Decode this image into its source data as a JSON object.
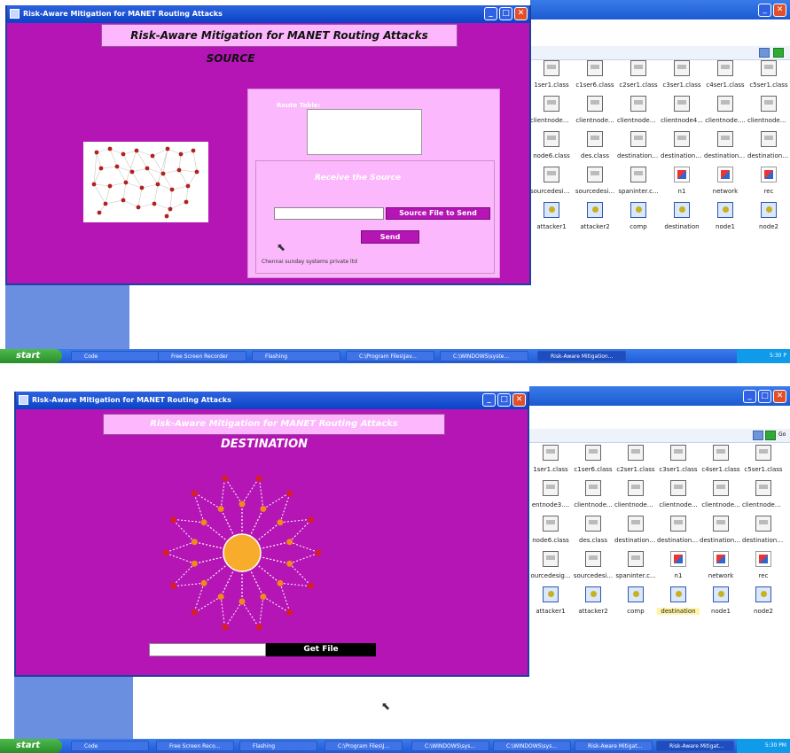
{
  "shot1": {
    "window_title": "Risk-Aware Mitigation for MANET Routing Attacks",
    "header": "Risk-Aware Mitigation for MANET Routing Attacks",
    "role": "SOURCE",
    "route_table_label": "Route Table:",
    "receive_label": "Receive the Source",
    "source_file_button": "Source File to Send",
    "send_button": "Send",
    "footer_note": "Chennai sunday systems private ltd",
    "files": [
      {
        "label": "1ser1.class",
        "kind": "class"
      },
      {
        "label": "c1ser6.class",
        "kind": "class"
      },
      {
        "label": "c2ser1.class",
        "kind": "class"
      },
      {
        "label": "c3ser1.class",
        "kind": "class"
      },
      {
        "label": "c4ser1.class",
        "kind": "class"
      },
      {
        "label": "c5ser1.class",
        "kind": "class"
      },
      {
        "label": "clientnode3....",
        "kind": "class"
      },
      {
        "label": "clientnode...",
        "kind": "class"
      },
      {
        "label": "clientnode4....",
        "kind": "class"
      },
      {
        "label": "clientnode4...",
        "kind": "class"
      },
      {
        "label": "clientnode....",
        "kind": "class"
      },
      {
        "label": "clientnode5....",
        "kind": "class"
      },
      {
        "label": "node6.class",
        "kind": "class"
      },
      {
        "label": "des.class",
        "kind": "class"
      },
      {
        "label": "destination....",
        "kind": "class"
      },
      {
        "label": "destination....",
        "kind": "class"
      },
      {
        "label": "destination....",
        "kind": "class"
      },
      {
        "label": "destination....",
        "kind": "class"
      },
      {
        "label": "sourcedesig...",
        "kind": "class"
      },
      {
        "label": "sourcedesi...",
        "kind": "class"
      },
      {
        "label": "spaninter.c...",
        "kind": "class"
      },
      {
        "label": "n1",
        "kind": "java"
      },
      {
        "label": "network",
        "kind": "java"
      },
      {
        "label": "rec",
        "kind": "java"
      },
      {
        "label": "attacker1",
        "kind": "exe"
      },
      {
        "label": "attacker2",
        "kind": "exe"
      },
      {
        "label": "comp",
        "kind": "exe"
      },
      {
        "label": "destination",
        "kind": "exe"
      },
      {
        "label": "node1",
        "kind": "exe"
      },
      {
        "label": "node2",
        "kind": "exe"
      }
    ],
    "taskbar": {
      "start": "start",
      "tasks": [
        "Code",
        "Free Screen Recorder",
        "Flashing",
        "C:\\Program Files\\Jav...",
        "C:\\WINDOWS\\syste...",
        "Risk-Aware Mitigation..."
      ],
      "clock": "5:30 P"
    }
  },
  "shot2": {
    "window_title": "Risk-Aware Mitigation for MANET Routing Attacks",
    "header": "Risk-Aware Mitigation for MANET Routing Attacks",
    "role": "DESTINATION",
    "get_file_button": "Get File",
    "addr_go": "Go",
    "files": [
      {
        "label": "1ser1.class",
        "kind": "class"
      },
      {
        "label": "c1ser6.class",
        "kind": "class"
      },
      {
        "label": "c2ser1.class",
        "kind": "class"
      },
      {
        "label": "c3ser1.class",
        "kind": "class"
      },
      {
        "label": "c4ser1.class",
        "kind": "class"
      },
      {
        "label": "c5ser1.class",
        "kind": "class"
      },
      {
        "label": "entnode3....",
        "kind": "class"
      },
      {
        "label": "clientnode...",
        "kind": "class"
      },
      {
        "label": "clientnode4....",
        "kind": "class"
      },
      {
        "label": "clientnode...",
        "kind": "class"
      },
      {
        "label": "clientnode...",
        "kind": "class"
      },
      {
        "label": "clientnode5....",
        "kind": "class"
      },
      {
        "label": "node6.class",
        "kind": "class"
      },
      {
        "label": "des.class",
        "kind": "class"
      },
      {
        "label": "destination....",
        "kind": "class"
      },
      {
        "label": "destination....",
        "kind": "class"
      },
      {
        "label": "destination....",
        "kind": "class"
      },
      {
        "label": "destination....",
        "kind": "class"
      },
      {
        "label": "ourcedesig...",
        "kind": "class"
      },
      {
        "label": "sourcedesi...",
        "kind": "class"
      },
      {
        "label": "spaninter.c...",
        "kind": "class"
      },
      {
        "label": "n1",
        "kind": "java"
      },
      {
        "label": "network",
        "kind": "java"
      },
      {
        "label": "rec",
        "kind": "java"
      },
      {
        "label": "attacker1",
        "kind": "exe"
      },
      {
        "label": "attacker2",
        "kind": "exe"
      },
      {
        "label": "comp",
        "kind": "exe"
      },
      {
        "label": "destination",
        "kind": "exe",
        "selected": true
      },
      {
        "label": "node1",
        "kind": "exe"
      },
      {
        "label": "node2",
        "kind": "exe"
      }
    ],
    "taskbar": {
      "start": "start",
      "tasks": [
        "Code",
        "Free Screen Reco...",
        "Flashing",
        "C:\\Program Files\\J...",
        "C:\\WINDOWS\\sys...",
        "C:\\WINDOWS\\sys...",
        "Risk-Aware Mitigat...",
        "Risk-Aware Mitigat..."
      ],
      "clock": "5:30 PM"
    }
  },
  "colors": {
    "app_bg": "#b515b5",
    "panel": "#fcb8fc",
    "title_bar": "#0a43c7",
    "taskbar": "#1f5bd6"
  }
}
